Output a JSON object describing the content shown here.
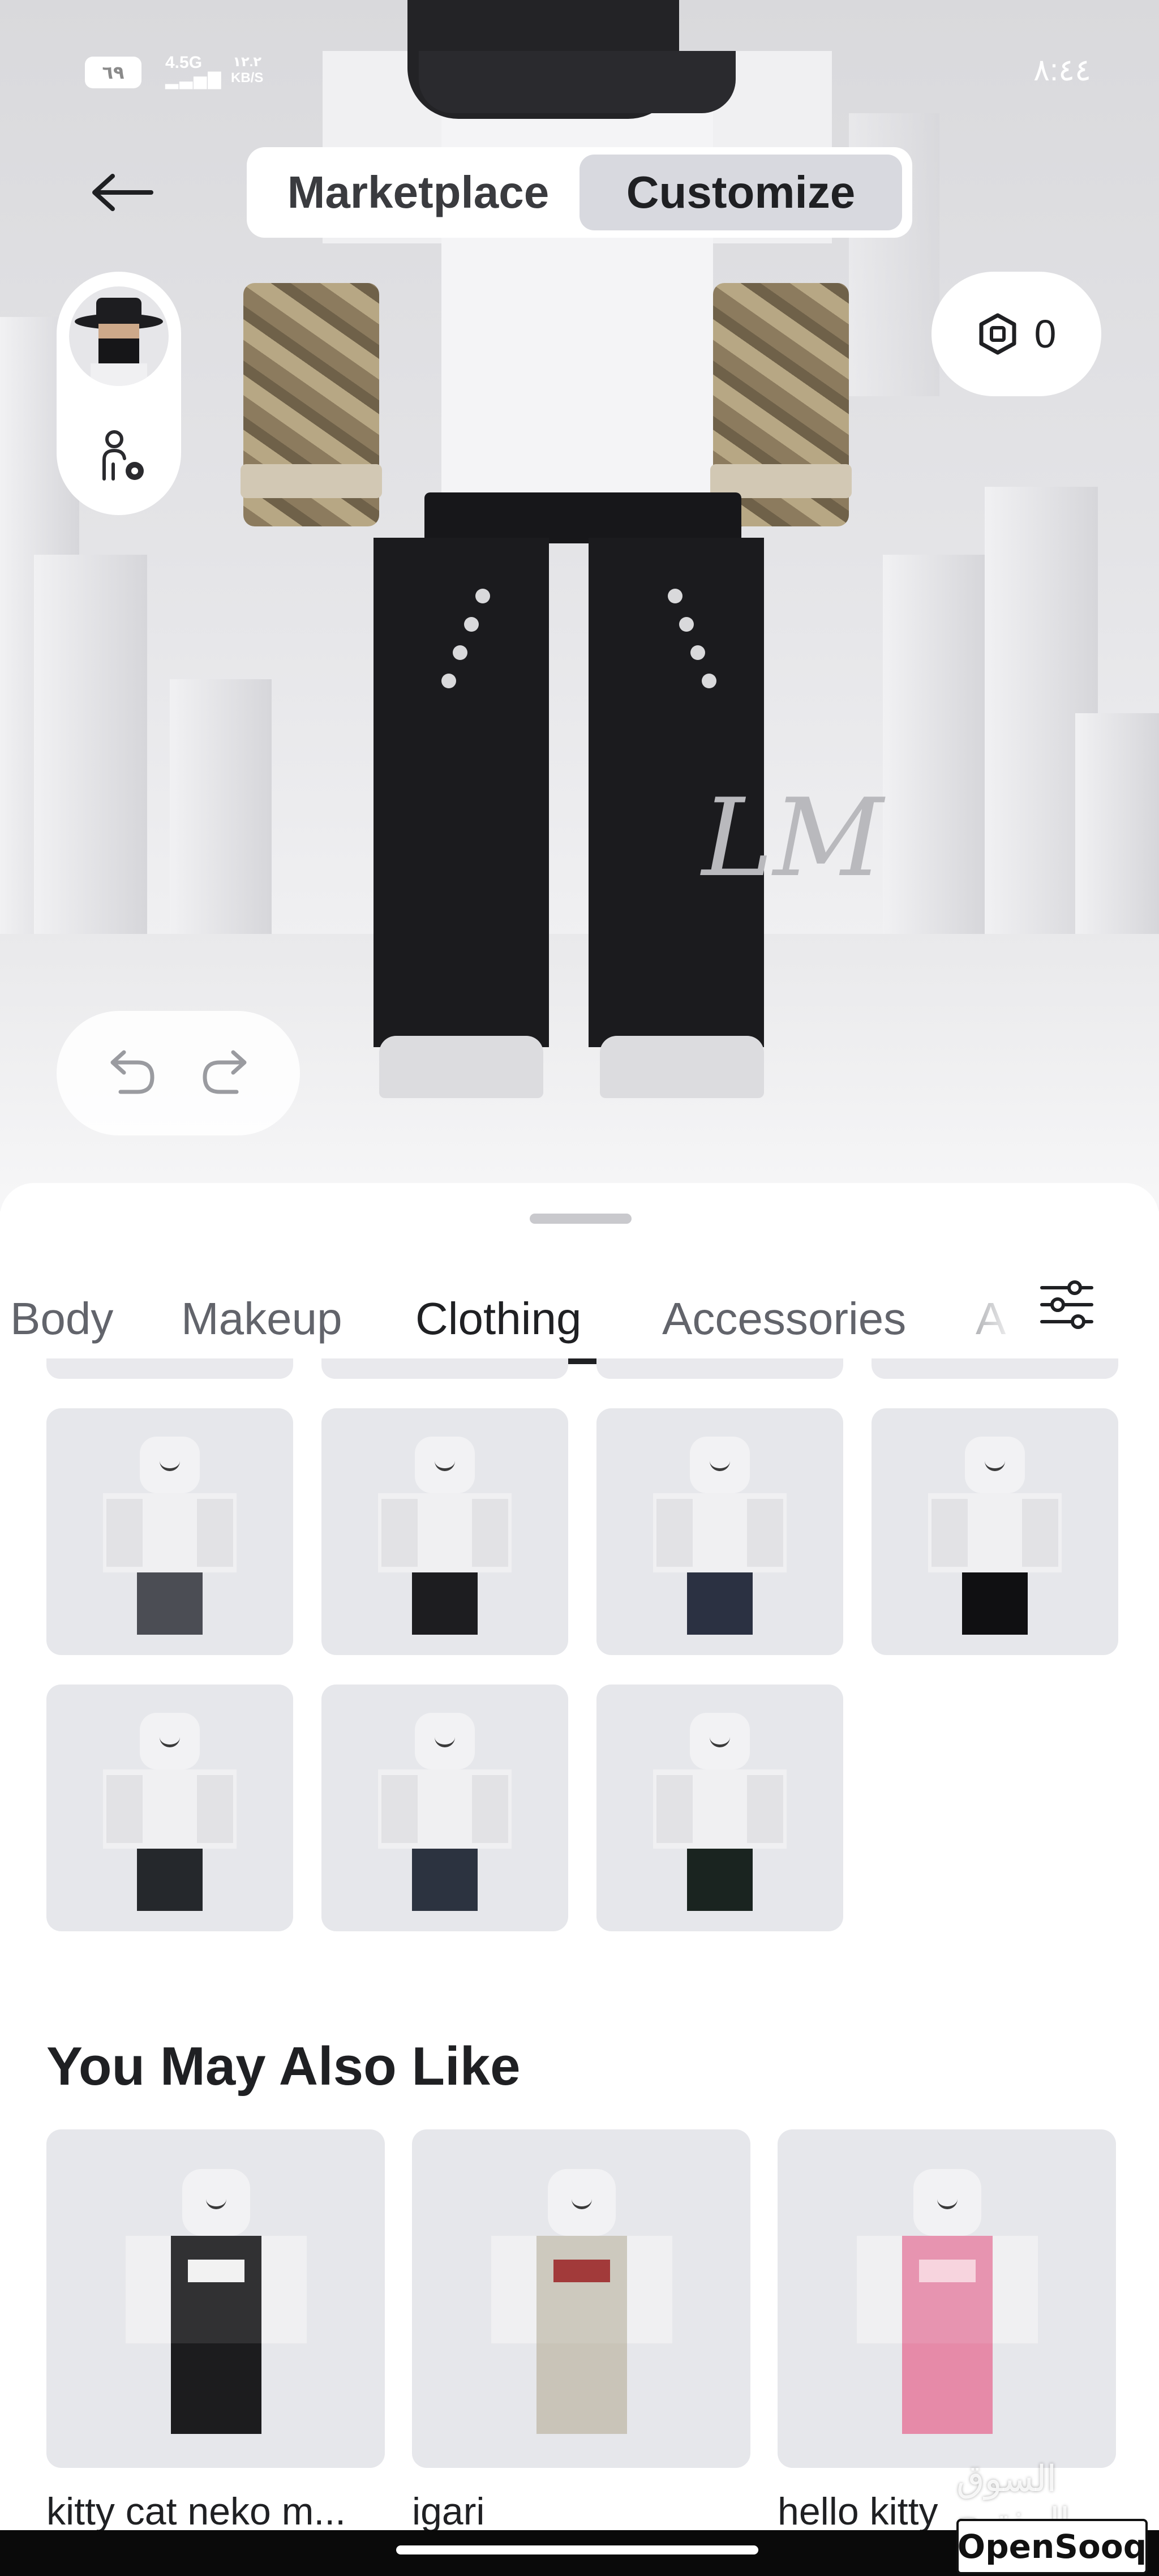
{
  "status_bar": {
    "battery": "٦٩",
    "network": "4.5G",
    "speed_value": "١٢.٢",
    "speed_unit": "KB/S",
    "time": "٨:٤٤"
  },
  "header": {
    "back_icon": "arrow-left-icon",
    "segments": [
      {
        "label": "Marketplace",
        "active": false
      },
      {
        "label": "Customize",
        "active": true
      }
    ]
  },
  "side_controls": {
    "avatar_icon": "avatar-thumbnail",
    "settings_icon": "avatar-settings-icon"
  },
  "robux": {
    "icon": "robux-icon",
    "balance": "0"
  },
  "history": {
    "undo_icon": "undo-icon",
    "redo_icon": "redo-icon"
  },
  "tabs": [
    {
      "label": "Body",
      "active": false
    },
    {
      "label": "Makeup",
      "active": false
    },
    {
      "label": "Clothing",
      "active": true
    },
    {
      "label": "Accessories",
      "active": false
    },
    {
      "label": "A",
      "active": false
    }
  ],
  "filter_icon": "sliders-icon",
  "items": [
    {
      "pants_color": "#4b4d54"
    },
    {
      "pants_color": "#1d1d20"
    },
    {
      "pants_color": "#2b3142"
    },
    {
      "pants_color": "#101012"
    },
    {
      "pants_color": "#25282c"
    },
    {
      "pants_color": "#2c3340"
    },
    {
      "pants_color": "#1a2420"
    }
  ],
  "recommendations": {
    "title": "You May Also Like",
    "items": [
      {
        "label": "kitty cat neko m...",
        "color": "#1c1c1e",
        "accent": "#f2f2f2"
      },
      {
        "label": "igari",
        "color": "#c9c4b8",
        "accent": "#a23a3a"
      },
      {
        "label": "hello kitty",
        "color": "#e68aa8",
        "accent": "#f7d4de"
      }
    ]
  },
  "watermark": {
    "arabic": "السوق المفتوح",
    "brand": "OpenSooq"
  },
  "colors": {
    "accent_text": "#1f2023",
    "tab_inactive": "#62646b",
    "tile_bg": "#e6e7eb"
  }
}
